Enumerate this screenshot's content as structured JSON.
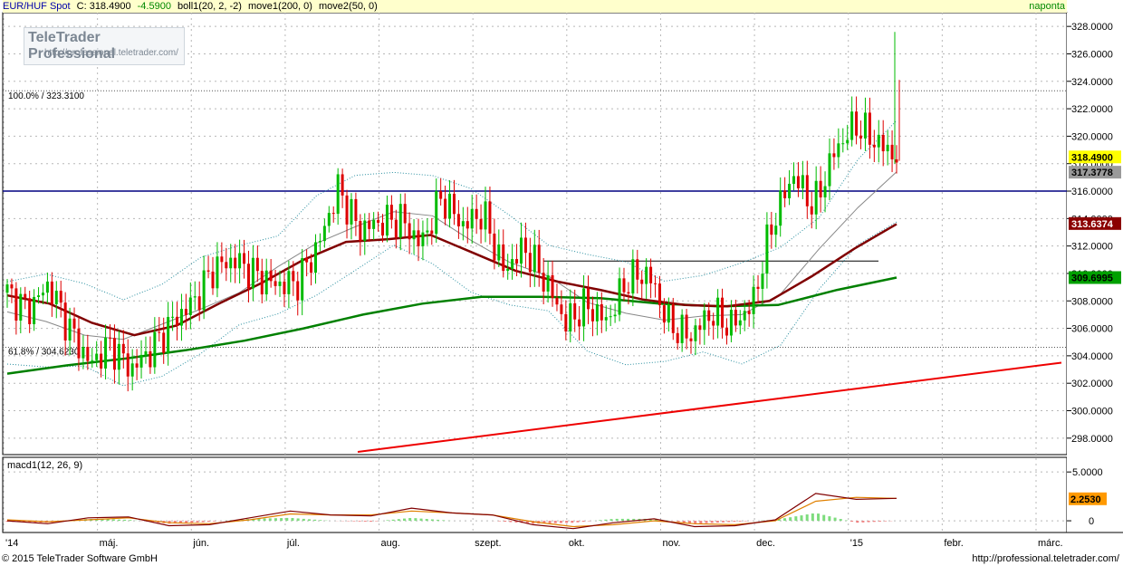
{
  "header": {
    "symbol": "EUR/HUF Spot",
    "close_label": "C: 318.4900",
    "change": "-4.5900",
    "boll": "boll1(20, 2, -2)",
    "move1": "move1(200, 0)",
    "move2": "move2(50, 0)",
    "period": "naponta"
  },
  "logo": {
    "title": "TeleTrader Professional",
    "url": "http://professional.teletrader.com/"
  },
  "footer": {
    "copyright": "© 2015 TeleTrader Software GmbH",
    "url": "http://professional.teletrader.com/"
  },
  "colors": {
    "up": "#00bb00",
    "down": "#dd0000",
    "ma200": "#008000",
    "ma50": "#800000",
    "trend": "#ee0000",
    "level": "#000080",
    "boll": "#2a8fa0"
  },
  "chart_data": [
    {
      "type": "candlestick",
      "title": "EUR/HUF Spot",
      "ylim": [
        296.8,
        329.0
      ],
      "y_ticks": [
        "328.0000",
        "326.0000",
        "324.0000",
        "322.0000",
        "320.0000",
        "318.0000",
        "316.0000",
        "314.0000",
        "312.0000",
        "310.0000",
        "308.0000",
        "306.0000",
        "304.0000",
        "302.0000",
        "300.0000",
        "298.0000"
      ],
      "x_ticks": [
        "'14",
        "máj.",
        "jún.",
        "júl.",
        "aug.",
        "szept.",
        "okt.",
        "nov.",
        "dec.",
        "'15",
        "febr.",
        "márc."
      ],
      "fib_labels": [
        "100.0% / 323.3100",
        "61.8% / 304.6230"
      ],
      "fib_levels": [
        323.31,
        304.623
      ],
      "horizontal_line": 316.0,
      "resistance_segment": 310.9,
      "trendline": {
        "from": [
          0,
          297.0
        ],
        "to": [
          1,
          303.5
        ]
      },
      "price_labels": {
        "close": "318.4900",
        "boll_mid": "317.3778",
        "ma50": "313.6374",
        "ma200": "309.6995"
      },
      "close_path": [
        308.6,
        307.3,
        309.2,
        306.0,
        303.4,
        304.8,
        303.0,
        304.5,
        306.5,
        307.9,
        310.4,
        311.0,
        309.9,
        309.2,
        309.3,
        311.9,
        316.2,
        313.2,
        313.7,
        314.0,
        312.1,
        315.6,
        313.5,
        314.4,
        310.2,
        311.9,
        309.5,
        306.4,
        307.7,
        306.5,
        309.6,
        310.0,
        306.3,
        305.4,
        307.1,
        306.2,
        307.6,
        313.7,
        317.2,
        314.8,
        318.9,
        320.9,
        319.6,
        318.5
      ],
      "bollinger_ma20": [
        307.2,
        306.5,
        305.5,
        305.2,
        306.3,
        307.4,
        308.6,
        310.5,
        312.2,
        313.4,
        314.5,
        314.2,
        312.4,
        310.8,
        309.8,
        307.9,
        307.1,
        306.6,
        306.9,
        307.0,
        308.5,
        311.8,
        314.8,
        317.4
      ],
      "ma50": [
        308.4,
        307.8,
        306.4,
        305.5,
        306.2,
        307.8,
        309.3,
        311.0,
        312.3,
        312.5,
        312.8,
        311.5,
        310.2,
        309.4,
        308.8,
        308.1,
        307.7,
        307.6,
        308.0,
        309.8,
        311.8,
        313.6
      ],
      "ma200": [
        302.7,
        303.3,
        303.8,
        304.4,
        305.1,
        306.0,
        307.0,
        307.8,
        308.3,
        308.3,
        308.2,
        307.8,
        307.6,
        307.7,
        308.8,
        309.7
      ]
    },
    {
      "type": "line",
      "title": "macd1(12, 26, 9)",
      "ylim": [
        -1.2,
        6.5
      ],
      "y_ticks": [
        "5.0000",
        "0"
      ],
      "value_label": "2.2530",
      "macd": [
        0.0,
        -0.3,
        0.3,
        0.4,
        -0.5,
        -0.4,
        0.3,
        1.0,
        0.6,
        0.5,
        1.3,
        0.8,
        0.6,
        -0.4,
        -0.8,
        -0.2,
        0.2,
        -0.6,
        -0.5,
        0.1,
        2.8,
        2.2,
        2.3
      ],
      "signal": [
        0.1,
        -0.1,
        0.1,
        0.3,
        -0.2,
        -0.3,
        0.1,
        0.7,
        0.6,
        0.6,
        1.0,
        0.8,
        0.6,
        -0.1,
        -0.6,
        -0.4,
        0.0,
        -0.3,
        -0.4,
        0.0,
        2.0,
        2.4,
        2.3
      ]
    }
  ]
}
